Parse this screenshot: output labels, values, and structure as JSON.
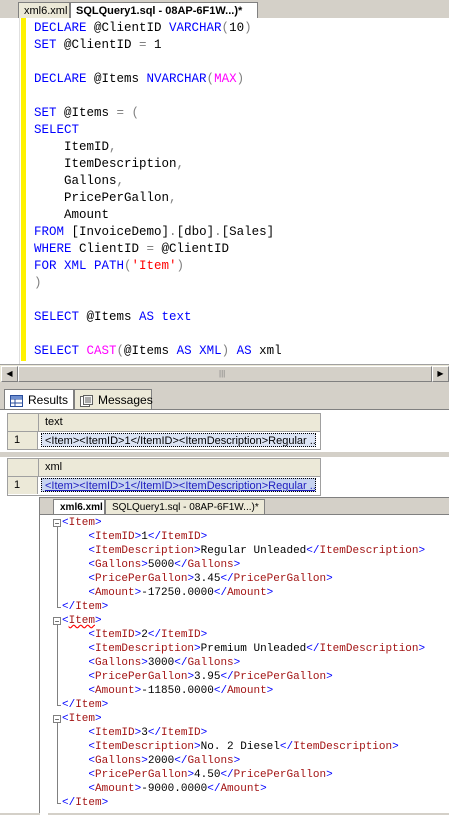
{
  "doc_tabs": [
    {
      "label": "xml6.xml",
      "active": false
    },
    {
      "label": "SQLQuery1.sql - 08AP-6F1W...)*",
      "active": true
    }
  ],
  "sql_lines": [
    [
      {
        "t": "DECLARE ",
        "c": "kw"
      },
      {
        "t": "@ClientID ",
        "c": ""
      },
      {
        "t": "VARCHAR",
        "c": "kw"
      },
      {
        "t": "(",
        "c": "op"
      },
      {
        "t": "10",
        "c": ""
      },
      {
        "t": ")",
        "c": "op"
      }
    ],
    [
      {
        "t": "SET ",
        "c": "kw"
      },
      {
        "t": "@ClientID ",
        "c": ""
      },
      {
        "t": "= ",
        "c": "op"
      },
      {
        "t": "1",
        "c": ""
      }
    ],
    [],
    [
      {
        "t": "DECLARE ",
        "c": "kw"
      },
      {
        "t": "@Items ",
        "c": ""
      },
      {
        "t": "NVARCHAR",
        "c": "kw"
      },
      {
        "t": "(",
        "c": "op"
      },
      {
        "t": "MAX",
        "c": "fn"
      },
      {
        "t": ")",
        "c": "op"
      }
    ],
    [],
    [
      {
        "t": "SET ",
        "c": "kw"
      },
      {
        "t": "@Items ",
        "c": ""
      },
      {
        "t": "= (",
        "c": "op"
      }
    ],
    [
      {
        "t": "SELECT",
        "c": "kw"
      }
    ],
    [
      {
        "t": "    ItemID",
        "c": ""
      },
      {
        "t": ",",
        "c": "op"
      }
    ],
    [
      {
        "t": "    ItemDescription",
        "c": ""
      },
      {
        "t": ",",
        "c": "op"
      }
    ],
    [
      {
        "t": "    Gallons",
        "c": ""
      },
      {
        "t": ",",
        "c": "op"
      }
    ],
    [
      {
        "t": "    PricePerGallon",
        "c": ""
      },
      {
        "t": ",",
        "c": "op"
      }
    ],
    [
      {
        "t": "    Amount",
        "c": ""
      }
    ],
    [
      {
        "t": "FROM ",
        "c": "kw"
      },
      {
        "t": "[InvoiceDemo]",
        "c": ""
      },
      {
        "t": ".",
        "c": "op"
      },
      {
        "t": "[dbo]",
        "c": ""
      },
      {
        "t": ".",
        "c": "op"
      },
      {
        "t": "[Sales]",
        "c": ""
      }
    ],
    [
      {
        "t": "WHERE ",
        "c": "kw"
      },
      {
        "t": "ClientID ",
        "c": ""
      },
      {
        "t": "= ",
        "c": "op"
      },
      {
        "t": "@ClientID",
        "c": ""
      }
    ],
    [
      {
        "t": "FOR XML PATH",
        "c": "kw"
      },
      {
        "t": "(",
        "c": "op"
      },
      {
        "t": "'Item'",
        "c": "str"
      },
      {
        "t": ")",
        "c": "op"
      }
    ],
    [
      {
        "t": ")",
        "c": "op"
      }
    ],
    [],
    [
      {
        "t": "SELECT ",
        "c": "kw"
      },
      {
        "t": "@Items ",
        "c": ""
      },
      {
        "t": "AS text",
        "c": "kw"
      }
    ],
    [],
    [
      {
        "t": "SELECT ",
        "c": "kw"
      },
      {
        "t": "CAST",
        "c": "fn"
      },
      {
        "t": "(",
        "c": "op"
      },
      {
        "t": "@Items ",
        "c": ""
      },
      {
        "t": "AS XML",
        "c": "kw"
      },
      {
        "t": ") ",
        "c": "op"
      },
      {
        "t": "AS ",
        "c": "kw"
      },
      {
        "t": "xml",
        "c": ""
      }
    ]
  ],
  "result_tabs": [
    {
      "label": "Results",
      "active": true
    },
    {
      "label": "Messages",
      "active": false
    }
  ],
  "grid1": {
    "column": "text",
    "row_num": "1",
    "value": "<Item><ItemID>1</ItemID><ItemDescription>Regular ..."
  },
  "grid2": {
    "column": "xml",
    "row_num": "1",
    "value": "<Item><ItemID>1</ItemID><ItemDescription>Regular ..."
  },
  "xml_tabs": [
    {
      "label": "xml6.xml",
      "active": true
    },
    {
      "label": "SQLQuery1.sql - 08AP-6F1W...)*",
      "active": false
    }
  ],
  "xml_items": [
    {
      "ItemID": "1",
      "ItemDescription": "Regular Unleaded",
      "Gallons": "5000",
      "PricePerGallon": "3.45",
      "Amount": "-17250.0000"
    },
    {
      "ItemID": "2",
      "ItemDescription": "Premium Unleaded",
      "Gallons": "3000",
      "PricePerGallon": "3.95",
      "Amount": "-11850.0000"
    },
    {
      "ItemID": "3",
      "ItemDescription": "No. 2 Diesel",
      "Gallons": "2000",
      "PricePerGallon": "4.50",
      "Amount": "-9000.0000"
    }
  ]
}
